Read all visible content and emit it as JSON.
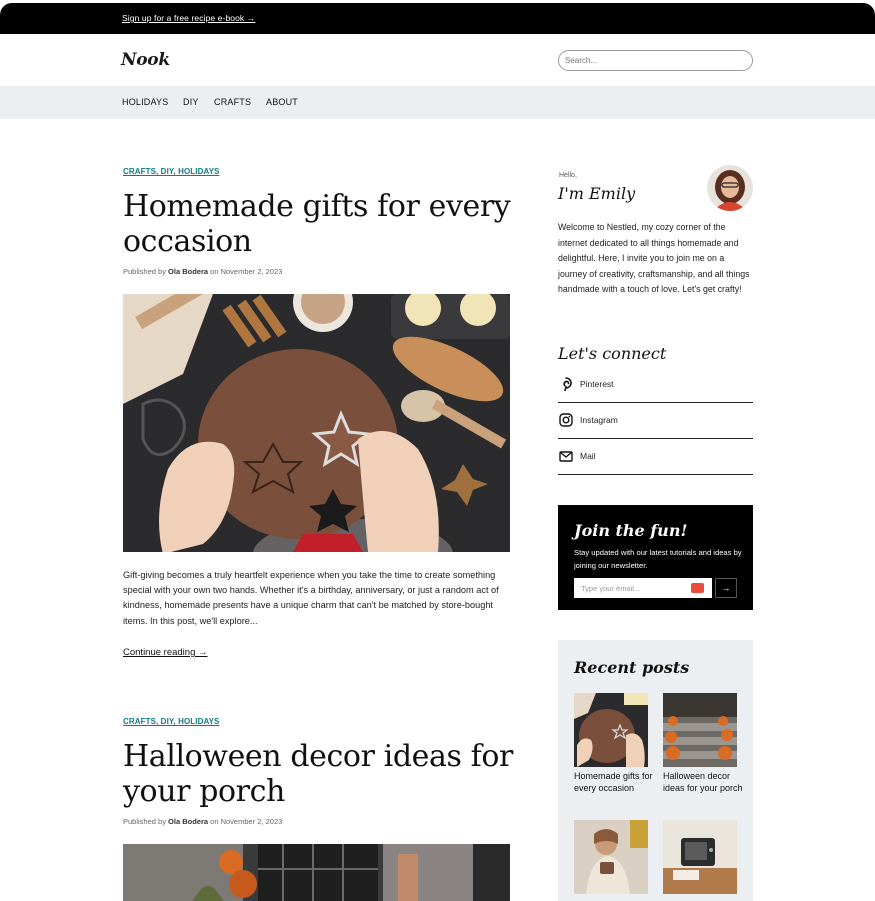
{
  "promo": {
    "text": "Sign up for a free recipe e-book →"
  },
  "header": {
    "logo": "Nook",
    "search_placeholder": "Search..."
  },
  "nav": {
    "items": [
      "HOLIDAYS",
      "DIY",
      "CRAFTS",
      "ABOUT"
    ]
  },
  "posts": [
    {
      "categories": "CRAFTS, DIY, HOLIDAYS",
      "title": "Homemade gifts for every occasion",
      "meta_prefix": "Published by",
      "author": "Ola Bodera",
      "meta_on": "on",
      "date": "November 2, 2023",
      "excerpt": "Gift-giving becomes a truly heartfelt experience when you take the time to create something special with your own two hands. Whether it's a birthday, anniversary, or just a random act of kindness, homemade presents have a unique charm that can't be matched by store-bought items. In this post, we'll explore...",
      "continue": "Continue reading →"
    },
    {
      "categories": "CRAFTS, DIY, HOLIDAYS",
      "title": "Halloween decor ideas for your porch",
      "meta_prefix": "Published by",
      "author": "Ola Bodera",
      "meta_on": "on",
      "date": "November 2, 2023"
    }
  ],
  "sidebar": {
    "hello": "Hello,",
    "name": "I'm Emily",
    "bio": "Welcome to Nestled, my cozy corner of the internet dedicated to all things homemade and delightful. Here, I invite you to join me on a journey of creativity, craftsmanship, and all things handmade with a touch of love. Let's get crafty!",
    "connect_heading": "Let's connect",
    "social": [
      {
        "label": "Pinterest",
        "icon": "pinterest-icon"
      },
      {
        "label": "Instagram",
        "icon": "instagram-icon"
      },
      {
        "label": "Mail",
        "icon": "mail-icon"
      }
    ],
    "newsletter": {
      "heading": "Join the fun!",
      "text": "Stay updated with our latest tutorials and ideas by joining our newsletter.",
      "placeholder": "Type your email...",
      "submit": "→"
    },
    "recent_heading": "Recent posts",
    "recent": [
      {
        "title": "Homemade gifts for every occasion"
      },
      {
        "title": "Halloween decor ideas for your porch"
      }
    ]
  },
  "colors": {
    "accent": "#127a86",
    "nav_bg": "#eceff2",
    "promo_bg": "#000000"
  }
}
